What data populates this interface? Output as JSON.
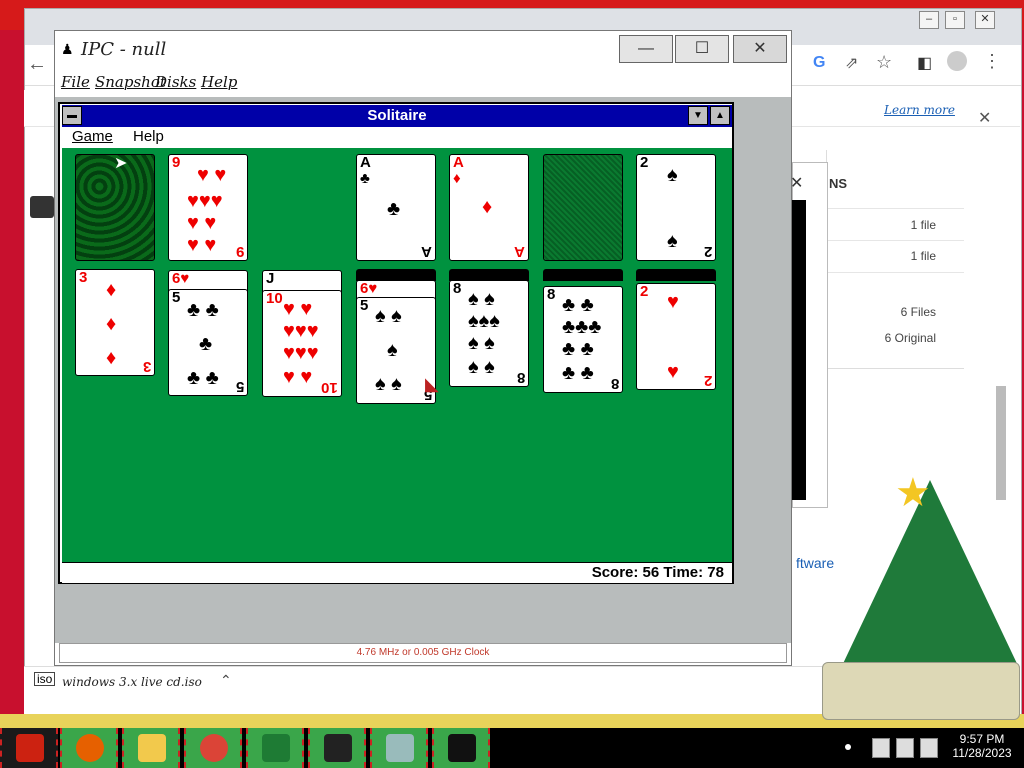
{
  "pcjs": {
    "title": "IPC - null",
    "menus": [
      "File",
      "Snapshot",
      "Disks",
      "Help"
    ],
    "controls": {
      "minimize": "—",
      "maximize": "☐",
      "close": "✕"
    },
    "status": "4.76 MHz or 0.005 GHz Clock"
  },
  "solitaire": {
    "title": "Solitaire",
    "menus": [
      "Game",
      "Help"
    ],
    "score_text": "Score: 56 Time: 78",
    "top_row": [
      {
        "type": "back",
        "pattern": "holly"
      },
      {
        "rank": "9",
        "suit": "♥",
        "color": "red"
      },
      {
        "rank": "A",
        "suit": "♣",
        "color": "black"
      },
      {
        "rank": "A",
        "suit": "♦",
        "color": "red"
      },
      {
        "type": "back",
        "pattern": "green"
      },
      {
        "rank": "2",
        "suit": "♠",
        "color": "black"
      }
    ],
    "tableau": [
      {
        "rank": "3",
        "suit": "♦",
        "color": "red"
      },
      {
        "rank": "5",
        "suit": "♣",
        "color": "black",
        "under": "6♥"
      },
      {
        "rank": "10",
        "suit": "♥",
        "color": "red",
        "under": "J"
      },
      {
        "rank": "5",
        "suit": "♠",
        "color": "black",
        "under": "6♥"
      },
      {
        "rank": "8",
        "suit": "♠",
        "color": "black"
      },
      {
        "rank": "8",
        "suit": "♣",
        "color": "black"
      },
      {
        "rank": "2",
        "suit": "♥",
        "color": "red"
      }
    ]
  },
  "browser": {
    "learn_more": "Learn more",
    "panel_rows": [
      "1 file",
      "1 file",
      "6 Files",
      "6 Original"
    ],
    "side_heading": "NS",
    "side_text": "ftware",
    "download_item": "windows 3.x live cd.iso"
  },
  "taskbar": {
    "time": "9:57 PM",
    "date": "11/28/2023",
    "apps": [
      "santa",
      "firefox",
      "explorer",
      "chrome",
      "tree",
      "terminal",
      "computer",
      "hat"
    ]
  }
}
